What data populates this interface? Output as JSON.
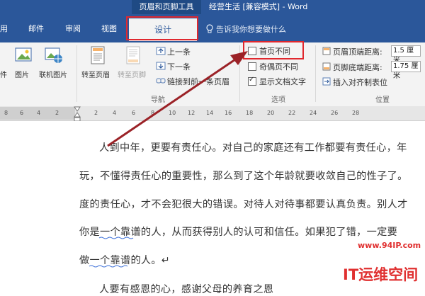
{
  "titlebar": {
    "context_tab_header": "页眉和页脚工具",
    "doc_title": "经营生活 [兼容模式] - Word"
  },
  "tabs": [
    {
      "label": "用"
    },
    {
      "label": "邮件"
    },
    {
      "label": "审阅"
    },
    {
      "label": "视图"
    },
    {
      "label": "设计"
    }
  ],
  "tellme": {
    "text": "告诉我你想要做什么"
  },
  "ribbon": {
    "insert_group": {
      "picture_suffix": "件",
      "picture": "图片",
      "online_picture": "联机图片"
    },
    "nav_group": {
      "go_header": "转至页眉",
      "go_footer": "转至页脚",
      "previous": "上一条",
      "next": "下一条",
      "link_previous": "链接到前一条页眉",
      "label": "导航"
    },
    "options_group": {
      "different_first": "首页不同",
      "different_odd_even": "奇偶页不同",
      "show_doc_text": "显示文档文字",
      "label": "选项",
      "different_first_checked": false,
      "different_odd_even_checked": false,
      "show_doc_text_checked": true
    },
    "position_group": {
      "header_from_top": "页眉顶端距离:",
      "header_value": "1.5 厘米",
      "footer_from_bottom": "页脚底端距离:",
      "footer_value": "1.75 厘米",
      "insert_align_tab": "插入对齐制表位",
      "label": "位置"
    }
  },
  "ruler": {
    "ticks": [
      "8",
      "6",
      "4",
      "2",
      "2",
      "4",
      "6",
      "8",
      "10",
      "12",
      "14",
      "16",
      "18",
      "20",
      "22",
      "24",
      "26",
      "28"
    ]
  },
  "document": {
    "lines": [
      "人到中年，更要有责任心。对自己的家庭还有工作都要有责任心，年",
      "玩，不懂得责任心的重要性，那么到了这个年龄就要收敛自己的性子了。",
      "度的责任心，才不会犯很大的错误。对待人对待事都要认真负责。别人才",
      "你是一个靠谱的人，从而获得别人的认可和信任。如果犯了错，一定要",
      "做一个靠谱的人。↵",
      "人要有感恩的心，感谢父母的养育之恩"
    ]
  },
  "watermark": {
    "url": "www.94IP.com",
    "brand": "IT运维空间"
  },
  "colors": {
    "accent": "#2b579a",
    "highlight_outline": "#e0282e",
    "arrow": "#9b2227"
  }
}
